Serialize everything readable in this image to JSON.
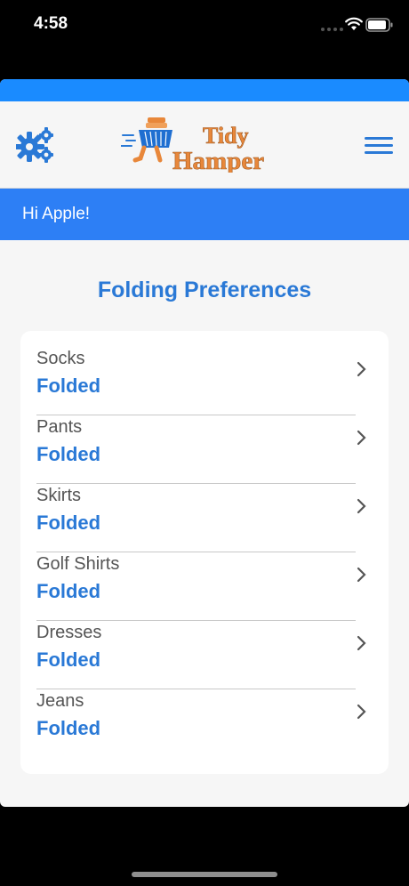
{
  "status_bar": {
    "time": "4:58"
  },
  "header": {
    "logo_line1": "Tidy",
    "logo_line2": "Hamper"
  },
  "greeting": "Hi Apple!",
  "page_title": "Folding Preferences",
  "preferences": [
    {
      "name": "Socks",
      "value": "Folded"
    },
    {
      "name": "Pants",
      "value": "Folded"
    },
    {
      "name": "Skirts",
      "value": "Folded"
    },
    {
      "name": "Golf Shirts",
      "value": "Folded"
    },
    {
      "name": "Dresses",
      "value": "Folded"
    },
    {
      "name": "Jeans",
      "value": "Folded"
    }
  ],
  "colors": {
    "accent_blue": "#2a79d6",
    "top_strip": "#1a8bff",
    "greeting_bar": "#2d7ff5",
    "logo_orange": "#e8873a"
  },
  "icons": [
    "settings-gears-icon",
    "hamburger-menu-icon",
    "chevron-right-icon",
    "wifi-icon",
    "battery-icon",
    "laundry-basket-icon"
  ]
}
